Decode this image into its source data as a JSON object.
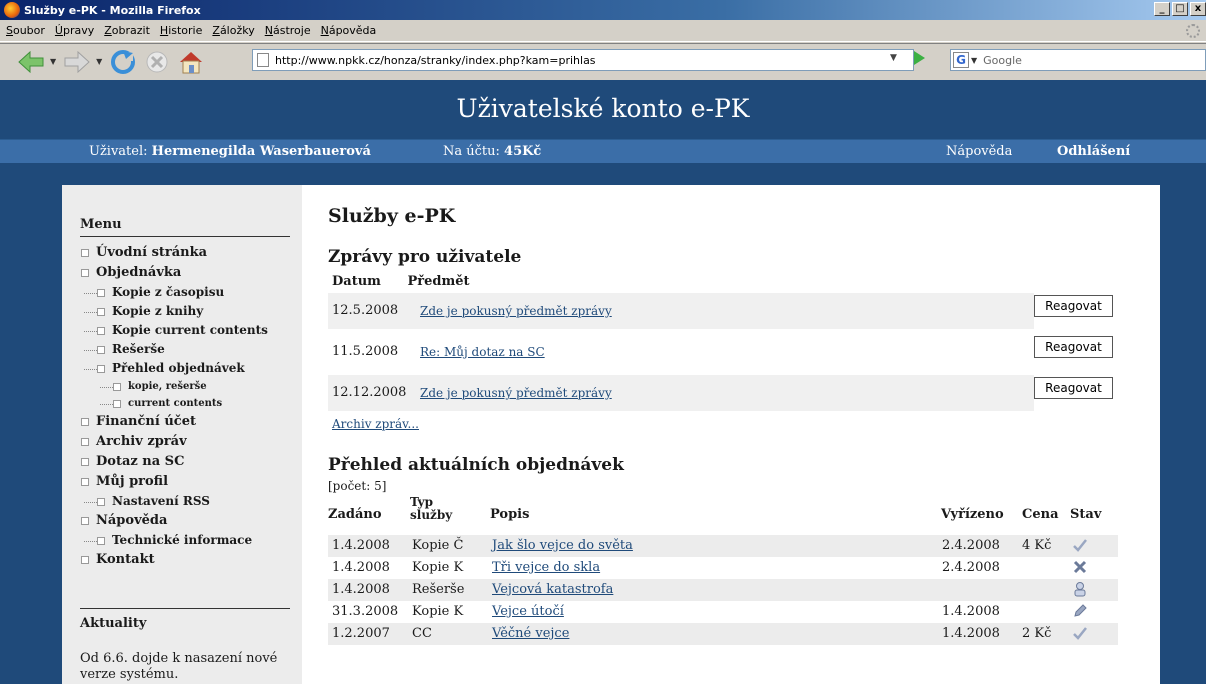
{
  "window": {
    "title": "Služby e-PK - Mozilla Firefox",
    "min": "_",
    "max": "□",
    "close": "x"
  },
  "menubar": [
    "Soubor",
    "Úpravy",
    "Zobrazit",
    "Historie",
    "Záložky",
    "Nástroje",
    "Nápověda"
  ],
  "toolbar": {
    "url": "http://www.npkk.cz/honza/stranky/index.php?kam=prihlas",
    "search_placeholder": "Google",
    "search_engine": "G"
  },
  "header": {
    "title": "Uživatelské konto e-PK"
  },
  "userbar": {
    "user_label": "Uživatel:",
    "user_name": "Hermenegilda Waserbauerová",
    "balance_label": "Na účtu:",
    "balance": "45Kč",
    "help": "Nápověda",
    "logout": "Odhlášení"
  },
  "sidebar": {
    "menu_title": "Menu",
    "items": [
      {
        "label": "Úvodní stránka",
        "level": 1
      },
      {
        "label": "Objednávka",
        "level": 1
      },
      {
        "label": "Kopie z časopisu",
        "level": 2
      },
      {
        "label": "Kopie z knihy",
        "level": 2
      },
      {
        "label": "Kopie current contents",
        "level": 2
      },
      {
        "label": "Rešerše",
        "level": 2
      },
      {
        "label": "Přehled objednávek",
        "level": 2
      },
      {
        "label": "kopie, rešerše",
        "level": 3
      },
      {
        "label": "current contents",
        "level": 3
      },
      {
        "label": "Finanční účet",
        "level": 1
      },
      {
        "label": "Archiv zpráv",
        "level": 1
      },
      {
        "label": "Dotaz na SC",
        "level": 1
      },
      {
        "label": "Můj profil",
        "level": 1
      },
      {
        "label": "Nastavení RSS",
        "level": 2
      },
      {
        "label": "Nápověda",
        "level": 1
      },
      {
        "label": "Technické informace",
        "level": 2
      },
      {
        "label": "Kontakt",
        "level": 1
      }
    ],
    "news_title": "Aktuality",
    "news_text": "Od 6.6. dojde k nasazení nové verze systému."
  },
  "main": {
    "title": "Služby e-PK",
    "messages_title": "Zprávy pro uživatele",
    "messages_columns": {
      "date": "Datum",
      "subject": "Předmět"
    },
    "messages": [
      {
        "date": "12.5.2008",
        "subject": "Zde je pokusný předmět zprávy",
        "action": "Reagovat"
      },
      {
        "date": "11.5.2008",
        "subject": "Re: Můj dotaz na SC",
        "action": "Reagovat"
      },
      {
        "date": "12.12.2008",
        "subject": "Zde je pokusný předmět zprávy",
        "action": "Reagovat"
      }
    ],
    "archive_link": "Archiv zpráv...",
    "orders_title": "Přehled aktuálních objednávek",
    "orders_count": "[počet: 5]",
    "orders_columns": {
      "placed": "Zadáno",
      "type_line1": "Typ",
      "type_line2": "služby",
      "description": "Popis",
      "done": "Vyřízeno",
      "price": "Cena",
      "state": "Stav"
    },
    "orders": [
      {
        "placed": "1.4.2008",
        "type": "Kopie Č",
        "description": "Jak šlo vejce do světa",
        "done": "2.4.2008",
        "price": "4 Kč",
        "state_icon": "check-icon"
      },
      {
        "placed": "1.4.2008",
        "type": "Kopie K",
        "description": "Tři vejce do skla",
        "done": "2.4.2008",
        "price": "",
        "state_icon": "cross-icon"
      },
      {
        "placed": "1.4.2008",
        "type": "Rešerše",
        "description": "Vejcová katastrofa",
        "done": "",
        "price": "",
        "state_icon": "person-icon"
      },
      {
        "placed": "31.3.2008",
        "type": "Kopie K",
        "description": "Vejce útočí",
        "done": "1.4.2008",
        "price": "",
        "state_icon": "pencil-icon"
      },
      {
        "placed": "1.2.2007",
        "type": "CC",
        "description": "Věčné vejce",
        "done": "1.4.2008",
        "price": "2 Kč",
        "state_icon": "check-icon"
      }
    ]
  },
  "colors": {
    "page_bg": "#1f4a7a",
    "userbar_bg": "#3b6ea8",
    "link": "#1f4a7a",
    "sidebar_bg": "#ececec"
  }
}
